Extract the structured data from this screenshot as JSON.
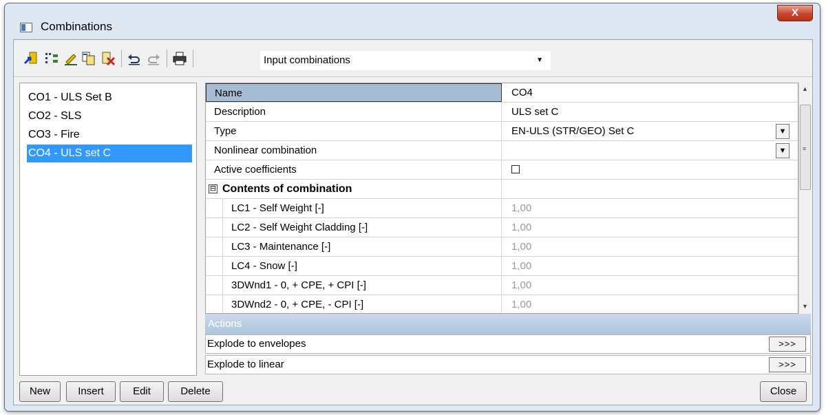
{
  "window": {
    "title": "Combinations",
    "close_glyph": "X"
  },
  "toolbar": {
    "icons": [
      "new-combination-icon",
      "properties-icon",
      "edit-pencil-icon",
      "copy-icon",
      "delete-icon",
      "undo-icon",
      "redo-icon",
      "print-icon"
    ],
    "view_select": "Input combinations"
  },
  "list": {
    "items": [
      "CO1 - ULS Set B",
      "CO2 - SLS",
      "CO3 - Fire",
      "CO4 - ULS set C"
    ],
    "selected_index": 3
  },
  "properties": {
    "name_label": "Name",
    "name_value": "CO4",
    "description_label": "Description",
    "description_value": "ULS set C",
    "type_label": "Type",
    "type_value": "EN-ULS (STR/GEO) Set C",
    "nonlinear_label": "Nonlinear combination",
    "nonlinear_value": "",
    "active_coeff_label": "Active coefficients",
    "active_coeff_checked": false,
    "contents_label": "Contents of combination",
    "contents_toggle": "⊟",
    "contents": [
      {
        "label": "LC1 - Self Weight [-]",
        "value": "1,00"
      },
      {
        "label": "LC2 - Self Weight Cladding [-]",
        "value": "1,00"
      },
      {
        "label": "LC3 - Maintenance [-]",
        "value": "1,00"
      },
      {
        "label": "LC4 - Snow [-]",
        "value": "1,00"
      },
      {
        "label": "3DWnd1 - 0, + CPE, + CPI [-]",
        "value": "1,00"
      },
      {
        "label": "3DWnd2 - 0, + CPE, - CPI [-]",
        "value": "1,00"
      }
    ]
  },
  "actions": {
    "header": "Actions",
    "explode_envelopes": "Explode to envelopes",
    "explode_linear": "Explode to linear",
    "button_label": ">>>"
  },
  "buttons": {
    "new": "New",
    "insert": "Insert",
    "edit": "Edit",
    "delete": "Delete",
    "close": "Close"
  }
}
